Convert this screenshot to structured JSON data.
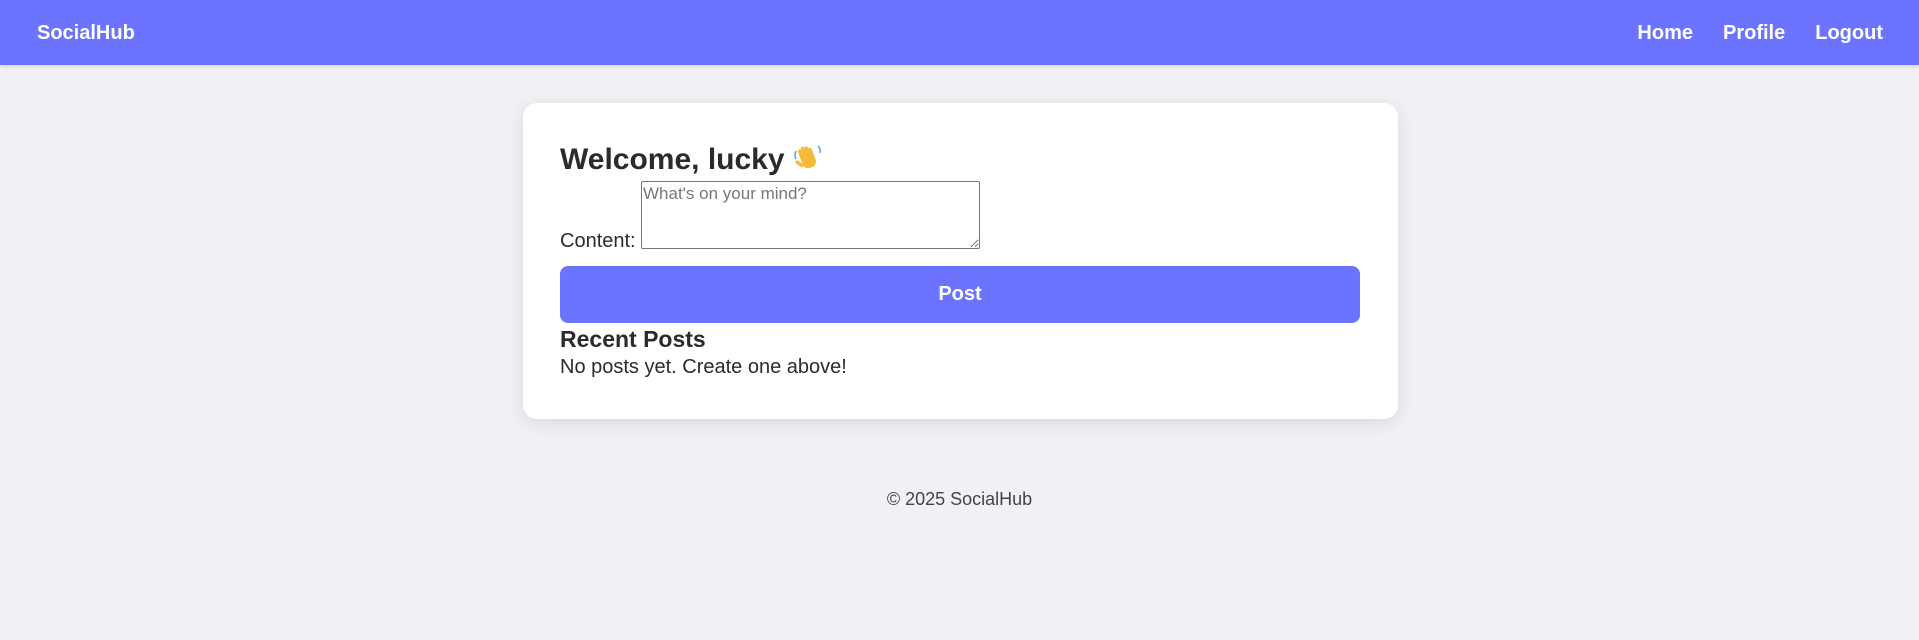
{
  "header": {
    "brand": "SocialHub",
    "nav": [
      {
        "label": "Home"
      },
      {
        "label": "Profile"
      },
      {
        "label": "Logout"
      }
    ]
  },
  "main": {
    "welcome_text": "Welcome, lucky",
    "welcome_icon": "waving-hand-icon",
    "content_label": "Content:",
    "content_value": "",
    "content_placeholder": "What's on your mind?",
    "post_button": "Post",
    "recent_heading": "Recent Posts",
    "empty_message": "No posts yet. Create one above!"
  },
  "footer": {
    "text": "© 2025 SocialHub"
  },
  "colors": {
    "accent": "#6c74ff",
    "background": "#f0f1f5",
    "card": "#ffffff"
  }
}
